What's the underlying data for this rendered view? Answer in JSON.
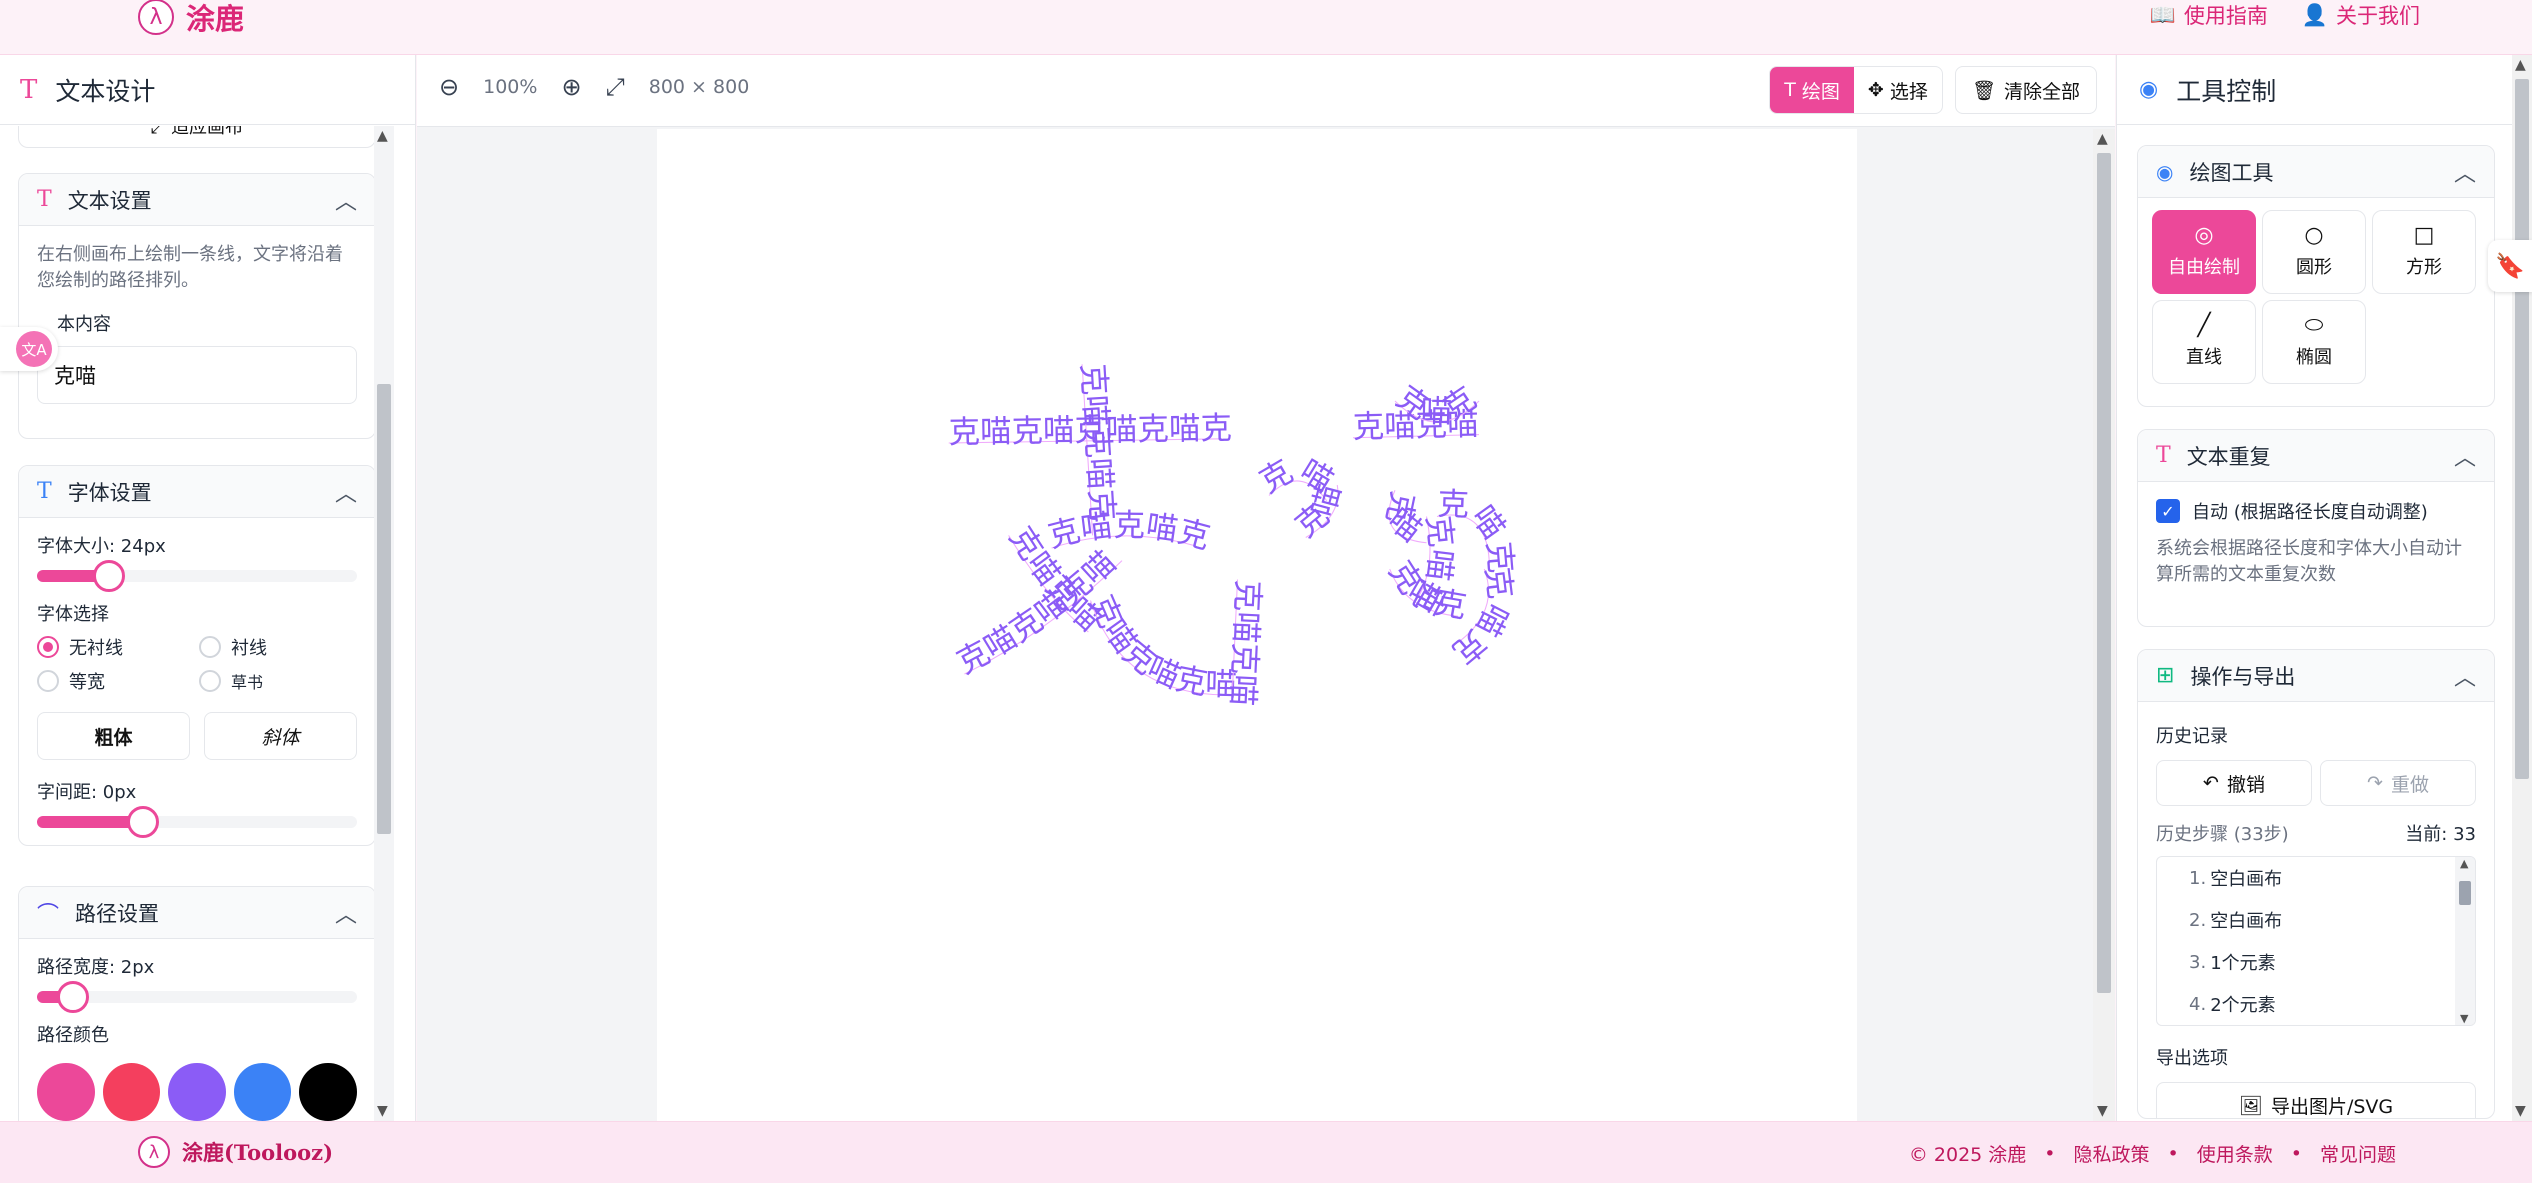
{
  "brand": {
    "name": "涂鹿",
    "logo_glyph": "λ"
  },
  "top_links": [
    {
      "label": "使用指南",
      "icon": "book-icon"
    },
    {
      "label": "关于我们",
      "icon": "user-icon"
    }
  ],
  "left": {
    "title": "文本设计",
    "fit_button": "适应画布",
    "text_settings": {
      "title": "文本设置",
      "description": "在右侧画布上绘制一条线，文字将沿着您绘制的路径排列。",
      "content_label": "本内容",
      "content_value": "克喵"
    },
    "font_settings": {
      "title": "字体设置",
      "size_label": "字体大小: 24px",
      "size_fraction": 0.22,
      "family_label": "字体选择",
      "families": [
        {
          "label": "无衬线",
          "selected": true
        },
        {
          "label": "衬线",
          "selected": false
        },
        {
          "label": "等宽",
          "selected": false
        },
        {
          "label": "草书",
          "selected": false
        }
      ],
      "bold_label": "粗体",
      "italic_label": "斜体",
      "spacing_label": "字间距: 0px",
      "spacing_fraction": 0.33
    },
    "path_settings": {
      "title": "路径设置",
      "width_label": "路径宽度: 2px",
      "width_fraction": 0.11,
      "color_label": "路径颜色",
      "colors": [
        "#ec4899",
        "#f43f5e",
        "#8b5cf6",
        "#3b82f6",
        "#000000"
      ]
    }
  },
  "toolbar": {
    "zoom": "100%",
    "canvas_size": "800 × 800",
    "mode_draw": "绘图",
    "mode_select": "选择",
    "clear_all": "清除全部"
  },
  "canvas": {
    "text_color": "#8b5cf6",
    "repeated_text": "克喵"
  },
  "right": {
    "title": "工具控制",
    "draw_tools": {
      "title": "绘图工具",
      "tools": [
        {
          "label": "自由绘制",
          "icon": "eye-icon",
          "active": true
        },
        {
          "label": "圆形",
          "icon": "circle-icon",
          "active": false
        },
        {
          "label": "方形",
          "icon": "square-icon",
          "active": false
        },
        {
          "label": "直线",
          "icon": "line-icon",
          "active": false
        },
        {
          "label": "椭圆",
          "icon": "ellipse-icon",
          "active": false
        }
      ]
    },
    "text_repeat": {
      "title": "文本重复",
      "auto_label": "自动 (根据路径长度自动调整)",
      "auto_checked": true,
      "description": "系统会根据路径长度和字体大小自动计算所需的文本重复次数"
    },
    "ops": {
      "title": "操作与导出",
      "history_label": "历史记录",
      "undo": "撤销",
      "redo": "重做",
      "steps_label": "历史步骤 (33步)",
      "current_label": "当前: 33",
      "history_items": [
        {
          "n": "1.",
          "label": "空白画布"
        },
        {
          "n": "2.",
          "label": "空白画布"
        },
        {
          "n": "3.",
          "label": "1个元素"
        },
        {
          "n": "4.",
          "label": "2个元素"
        }
      ],
      "export_label": "导出选项",
      "export_button": "导出图片/SVG"
    }
  },
  "footer": {
    "brand": "涂鹿(Toolooz)",
    "links": [
      "© 2025 涂鹿",
      "隐私政策",
      "使用条款",
      "常见问题"
    ]
  }
}
